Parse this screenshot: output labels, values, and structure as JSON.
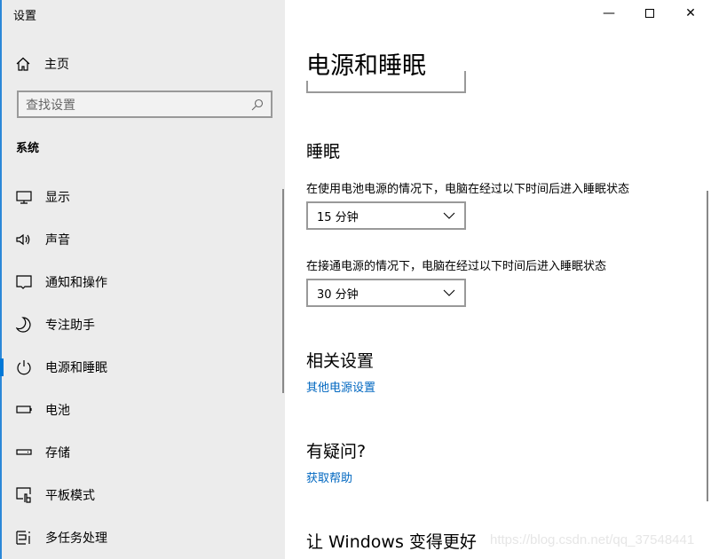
{
  "window": {
    "title": "设置",
    "controls": [
      "minimize",
      "maximize",
      "close"
    ]
  },
  "sidebar": {
    "home": "主页",
    "search_placeholder": "查找设置",
    "section": "系统",
    "items": [
      {
        "label": "显示",
        "icon": "monitor-icon"
      },
      {
        "label": "声音",
        "icon": "speaker-icon"
      },
      {
        "label": "通知和操作",
        "icon": "notification-icon"
      },
      {
        "label": "专注助手",
        "icon": "moon-icon"
      },
      {
        "label": "电源和睡眠",
        "icon": "power-icon",
        "active": true
      },
      {
        "label": "电池",
        "icon": "battery-icon"
      },
      {
        "label": "存储",
        "icon": "storage-icon"
      },
      {
        "label": "平板模式",
        "icon": "tablet-icon"
      },
      {
        "label": "多任务处理",
        "icon": "multitask-icon"
      }
    ]
  },
  "main": {
    "title": "电源和睡眠",
    "sleep": {
      "heading": "睡眠",
      "battery_label": "在使用电池电源的情况下，电脑在经过以下时间后进入睡眠状态",
      "battery_value": "15 分钟",
      "plugged_label": "在接通电源的情况下，电脑在经过以下时间后进入睡眠状态",
      "plugged_value": "30 分钟"
    },
    "related": {
      "heading": "相关设置",
      "link": "其他电源设置"
    },
    "question": {
      "heading": "有疑问?",
      "link": "获取帮助"
    },
    "improve": {
      "heading": "让 Windows 变得更好"
    }
  },
  "watermark": "https://blog.csdn.net/qq_37548441",
  "colors": {
    "accent": "#0078d7",
    "link": "#0067c0",
    "sidebar_bg": "#ececec"
  }
}
